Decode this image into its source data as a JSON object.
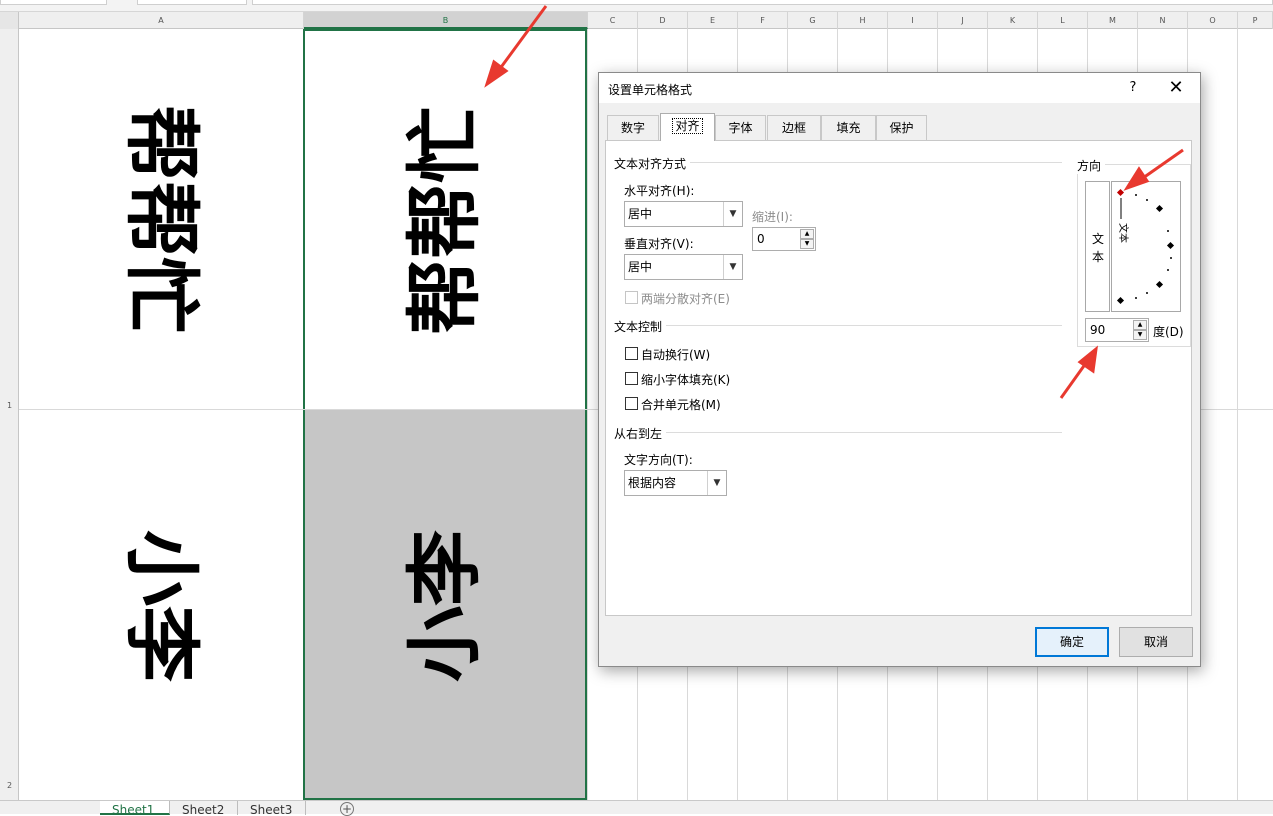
{
  "spreadsheet": {
    "columns": [
      "A",
      "B",
      "C",
      "D",
      "E",
      "F",
      "G",
      "H",
      "I",
      "J",
      "K",
      "L",
      "M",
      "N",
      "O",
      "P"
    ],
    "rows": [
      "1",
      "2"
    ],
    "cells": {
      "a1": "帮帮忙",
      "b1": "帮帮忙",
      "a2": "小李",
      "b2": "小李"
    },
    "sheet_tabs": [
      "Sheet1",
      "Sheet2",
      "Sheet3"
    ],
    "add_sheet_symbol": "+"
  },
  "dialog": {
    "title": "设置单元格格式",
    "help": "?",
    "close": "✕",
    "tabs": [
      "数字",
      "对齐",
      "字体",
      "边框",
      "填充",
      "保护"
    ],
    "active_tab": "对齐",
    "text_alignment": {
      "section": "文本对齐方式",
      "horizontal_label": "水平对齐(H):",
      "horizontal_value": "居中",
      "indent_label": "缩进(I):",
      "indent_value": "0",
      "vertical_label": "垂直对齐(V):",
      "vertical_value": "居中",
      "distributed_label": "两端分散对齐(E)"
    },
    "text_control": {
      "section": "文本控制",
      "wrap": "自动换行(W)",
      "shrink": "缩小字体填充(K)",
      "merge": "合并单元格(M)"
    },
    "rtl": {
      "section": "从右到左",
      "direction_label": "文字方向(T):",
      "direction_value": "根据内容"
    },
    "orientation": {
      "section": "方向",
      "vertical_text": "文本",
      "dial_text": "文本",
      "degrees_value": "90",
      "degrees_label": "度(D)",
      "degrees": 90
    },
    "ok": "确定",
    "cancel": "取消"
  },
  "colors": {
    "excel_green": "#217346",
    "annotation_red": "#e8392f",
    "selection_gray": "#c6c6c6",
    "dialog_accent": "#0078d7"
  }
}
